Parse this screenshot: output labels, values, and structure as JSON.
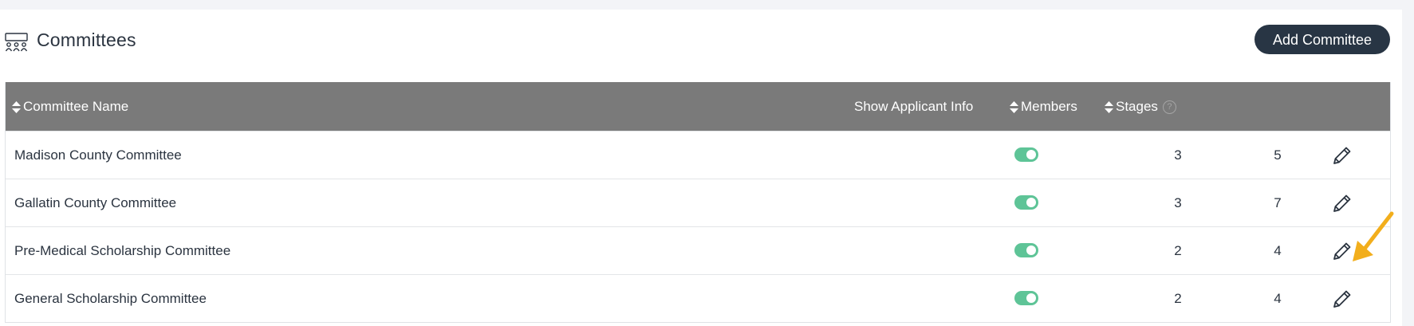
{
  "header": {
    "title": "Committees",
    "add_button_label": "Add Committee"
  },
  "table": {
    "columns": {
      "name": "Committee Name",
      "show_applicant_info": "Show Applicant Info",
      "members": "Members",
      "stages": "Stages"
    },
    "rows": [
      {
        "name": "Madison County Committee",
        "show_applicant_info": true,
        "members": "3",
        "stages": "5"
      },
      {
        "name": "Gallatin County Committee",
        "show_applicant_info": true,
        "members": "3",
        "stages": "7"
      },
      {
        "name": "Pre-Medical Scholarship Committee",
        "show_applicant_info": true,
        "members": "2",
        "stages": "4"
      },
      {
        "name": "General Scholarship Committee",
        "show_applicant_info": true,
        "members": "2",
        "stages": "4"
      }
    ]
  },
  "icons": {
    "title": "committee-icon",
    "sort": "sort-icon",
    "help": "help-icon",
    "edit": "pencil-icon",
    "annotation": "arrow-icon"
  },
  "colors": {
    "header_bg": "#7a7a7a",
    "button_bg": "#283544",
    "toggle_on": "#5ec497",
    "arrow": "#f2ae1c"
  }
}
